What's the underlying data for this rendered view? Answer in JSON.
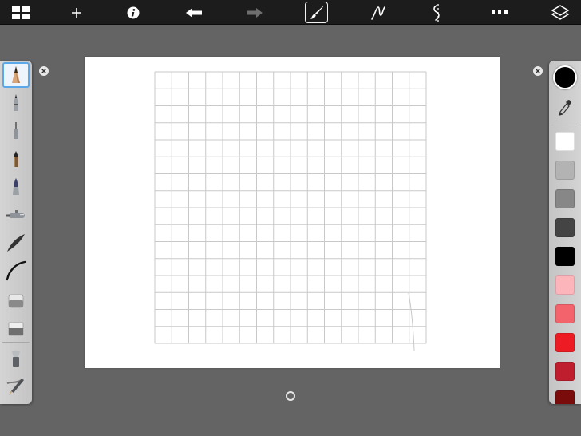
{
  "toolbar": {
    "items": [
      {
        "name": "gallery-grid-icon"
      },
      {
        "name": "add-icon"
      },
      {
        "name": "info-icon"
      },
      {
        "name": "undo-icon"
      },
      {
        "name": "redo-icon"
      },
      {
        "name": "brush-icon",
        "selected": true
      },
      {
        "name": "stroke-curve-icon"
      },
      {
        "name": "symmetry-icon"
      },
      {
        "name": "more-dots-icon"
      },
      {
        "name": "layers-icon"
      }
    ],
    "redo_enabled": false
  },
  "brushes": {
    "items": [
      {
        "name": "pencil-brush",
        "selected": true
      },
      {
        "name": "ballpoint-pen-brush"
      },
      {
        "name": "fineliner-brush"
      },
      {
        "name": "marker-brush"
      },
      {
        "name": "paintbrush-brush"
      },
      {
        "name": "airbrush-brush"
      },
      {
        "name": "soft-brush"
      },
      {
        "name": "hard-brush"
      },
      {
        "name": "soft-eraser-brush"
      },
      {
        "name": "hard-eraser-brush"
      },
      {
        "name": "blender-brush"
      },
      {
        "name": "smudge-brush"
      }
    ]
  },
  "canvas": {
    "grid_rows": 16,
    "grid_cols": 16,
    "background": "#ffffff",
    "grid_color": "#c9c9c9"
  },
  "colors": {
    "current": "#000000",
    "swatches": [
      "#ffffff",
      "#b3b3b3",
      "#878787",
      "#444444",
      "#000000",
      "#fcb6bb",
      "#f2636b",
      "#ed1c24",
      "#be1e2d",
      "#7a0c0c"
    ]
  }
}
